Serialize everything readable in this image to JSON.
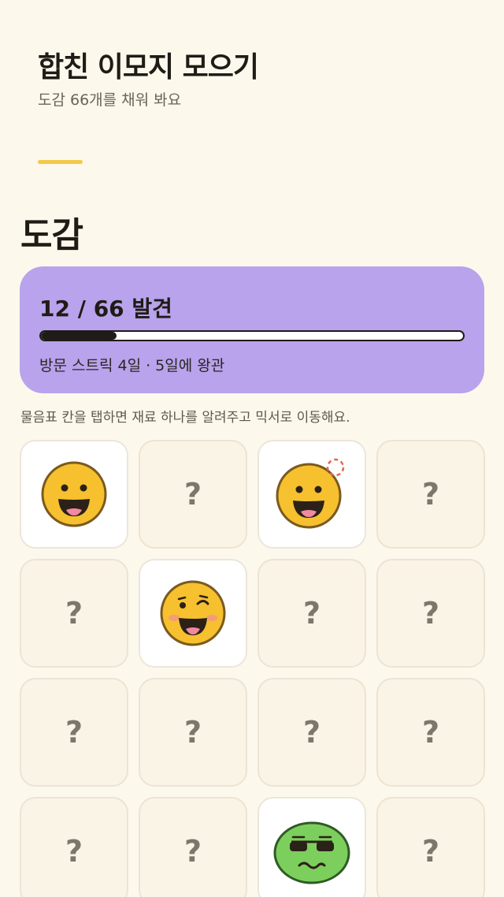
{
  "header": {
    "title": "합친 이모지 모으기",
    "subtitle": "도감 66개를 채워 봐요"
  },
  "section": {
    "title": "도감"
  },
  "progress": {
    "count_text": "12 / 66 발견",
    "found": 12,
    "total": 66,
    "fraction": 0.18,
    "streak_text": "방문 스트릭 4일 · 5일에 왕관"
  },
  "hint": "물음표 칸을 탭하면 재료 하나를 알려주고 믹서로 이동해요.",
  "grid": {
    "placeholder": "?",
    "cells": [
      {
        "state": "found",
        "icon": "grinning-face-icon"
      },
      {
        "state": "locked",
        "icon": "question-mark"
      },
      {
        "state": "found",
        "icon": "grinning-face-with-sparkle-icon"
      },
      {
        "state": "locked",
        "icon": "question-mark"
      },
      {
        "state": "locked",
        "icon": "question-mark"
      },
      {
        "state": "found",
        "icon": "winking-face-icon"
      },
      {
        "state": "locked",
        "icon": "question-mark"
      },
      {
        "state": "locked",
        "icon": "question-mark"
      },
      {
        "state": "locked",
        "icon": "question-mark"
      },
      {
        "state": "locked",
        "icon": "question-mark"
      },
      {
        "state": "locked",
        "icon": "question-mark"
      },
      {
        "state": "locked",
        "icon": "question-mark"
      },
      {
        "state": "locked",
        "icon": "question-mark"
      },
      {
        "state": "locked",
        "icon": "question-mark"
      },
      {
        "state": "found",
        "icon": "green-sunglasses-face-icon"
      },
      {
        "state": "locked",
        "icon": "question-mark"
      }
    ]
  },
  "colors": {
    "background": "#fdf8ec",
    "accent": "#f3c94a",
    "card": "#b8a3ec",
    "emoji_yellow": "#f7c02f",
    "emoji_green": "#7ccf5c"
  }
}
